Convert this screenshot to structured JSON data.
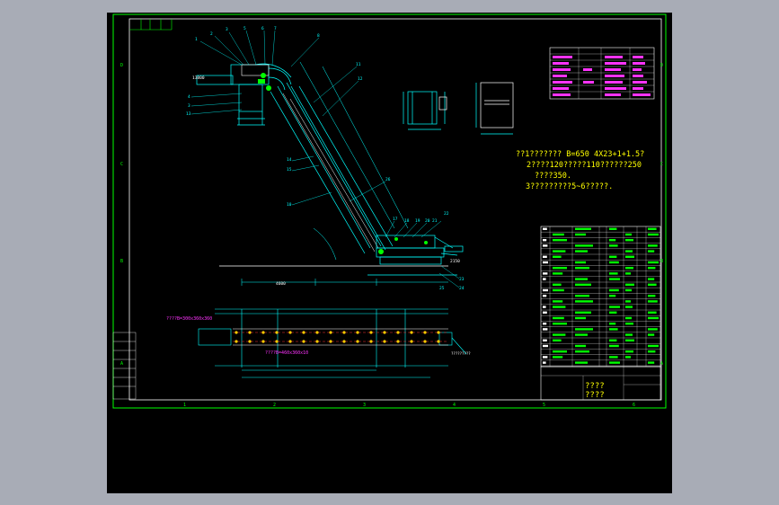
{
  "colors": {
    "frame": "#00ff00",
    "inner": "#ffffff",
    "drawing": "#00ffff",
    "note": "#ffff00",
    "title_table": "#ff33ff",
    "chain": "#ff3333",
    "pins": "#ffcc00"
  },
  "frame": {
    "left_letters": [
      "D",
      "C",
      "B",
      "A"
    ],
    "right_letters": [
      "D",
      "C",
      "B",
      "A"
    ],
    "bottom_numbers": [
      "1",
      "2",
      "3",
      "4",
      "5",
      "6"
    ]
  },
  "notes": {
    "line1": "??1???????    B=650   4X23+1+1.5?",
    "line2": "2????120?????110??????250",
    "line3": "????350.",
    "line4": "3?????????5~6?????."
  },
  "side_view": {
    "callouts": [
      "1",
      "2",
      "3",
      "4",
      "5",
      "6",
      "7",
      "8",
      "9",
      "10",
      "11",
      "12",
      "13",
      "14",
      "15",
      "16",
      "17",
      "18",
      "19",
      "20",
      "21",
      "22",
      "23",
      "24",
      "25",
      "26"
    ],
    "dim_height": "13800",
    "dim_base": "4600",
    "dim_right": "2150"
  },
  "plan_view": {
    "label_left": "????B=300x360x360",
    "label_center": "????B=460x360x10",
    "label_right": "?????????"
  },
  "title_block": {
    "marks": [
      "????"
    ]
  }
}
